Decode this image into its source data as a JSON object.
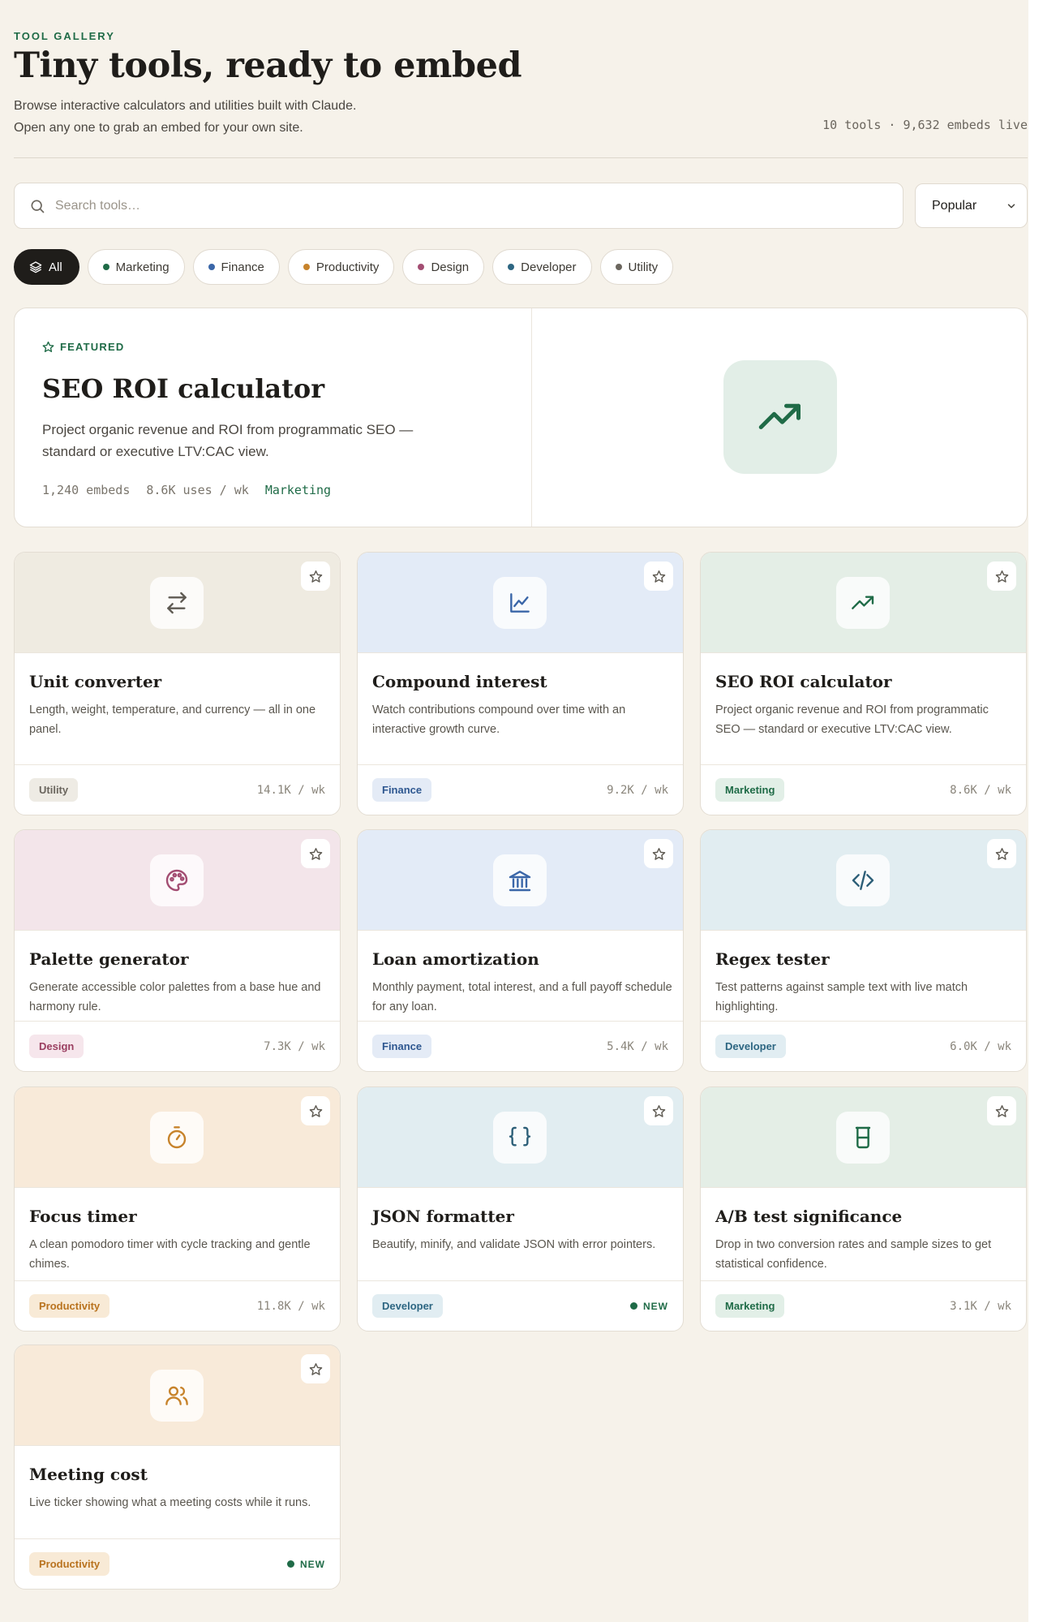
{
  "header": {
    "eyebrow": "TOOL GALLERY",
    "title": "Tiny tools, ready to embed",
    "subtitle_line1": "Browse interactive calculators and utilities built with Claude.",
    "subtitle_line2": "Open any one to grab an embed for your own site.",
    "stats": "10 tools · 9,632 embeds live"
  },
  "search": {
    "placeholder": "Search tools…"
  },
  "sort": {
    "selected": "Popular"
  },
  "filters": [
    {
      "label": "All",
      "active": true
    },
    {
      "label": "Marketing",
      "color": "#1f6b47"
    },
    {
      "label": "Finance",
      "color": "#3a66a8"
    },
    {
      "label": "Productivity",
      "color": "#c7832b"
    },
    {
      "label": "Design",
      "color": "#a34d72"
    },
    {
      "label": "Developer",
      "color": "#2d6682"
    },
    {
      "label": "Utility",
      "color": "#6b665e"
    }
  ],
  "featured": {
    "label": "FEATURED",
    "title": "SEO ROI calculator",
    "desc": "Project organic revenue and ROI from programmatic SEO — standard or executive LTV:CAC view.",
    "embeds": "1,240 embeds",
    "uses": "8.6K uses / wk",
    "category": "Marketing",
    "icon": "trending-up-icon"
  },
  "tools": [
    {
      "title": "Unit converter",
      "desc": "Length, weight, temperature, and currency — all in one panel.",
      "tag": "Utility",
      "uses": "14.1K / wk",
      "icon": "swap-arrows-icon",
      "banner": "#efebe1",
      "color": "#5e5a52"
    },
    {
      "title": "Compound interest",
      "desc": "Watch contributions compound over time with an interactive growth curve.",
      "tag": "Finance",
      "uses": "9.2K / wk",
      "icon": "line-chart-icon",
      "banner": "#e3ebf7",
      "color": "#3a66a8"
    },
    {
      "title": "SEO ROI calculator",
      "desc": "Project organic revenue and ROI from programmatic SEO — standard or executive LTV:CAC view.",
      "tag": "Marketing",
      "uses": "8.6K / wk",
      "icon": "trending-up-icon",
      "banner": "#e4eee6",
      "color": "#1f6b47"
    },
    {
      "title": "Palette generator",
      "desc": "Generate accessible color palettes from a base hue and harmony rule.",
      "tag": "Design",
      "uses": "7.3K / wk",
      "icon": "palette-icon",
      "banner": "#f3e5ea",
      "color": "#a34d72"
    },
    {
      "title": "Loan amortization",
      "desc": "Monthly payment, total interest, and a full payoff schedule for any loan.",
      "tag": "Finance",
      "uses": "5.4K / wk",
      "icon": "bank-icon",
      "banner": "#e3ebf7",
      "color": "#3a66a8"
    },
    {
      "title": "Regex tester",
      "desc": "Test patterns against sample text with live match highlighting.",
      "tag": "Developer",
      "uses": "6.0K / wk",
      "icon": "code-icon",
      "banner": "#e1edf1",
      "color": "#2d5f78"
    },
    {
      "title": "Focus timer",
      "desc": "A clean pomodoro timer with cycle tracking and gentle chimes.",
      "tag": "Productivity",
      "uses": "11.8K / wk",
      "icon": "timer-icon",
      "banner": "#f8ead9",
      "color": "#c7832b"
    },
    {
      "title": "JSON formatter",
      "desc": "Beautify, minify, and validate JSON with error pointers.",
      "tag": "Developer",
      "uses": "NEW",
      "icon": "braces-icon",
      "banner": "#e1edf1",
      "color": "#2d5f78"
    },
    {
      "title": "A/B test significance",
      "desc": "Drop in two conversion rates and sample sizes to get statistical confidence.",
      "tag": "Marketing",
      "uses": "3.1K / wk",
      "icon": "beaker-icon",
      "banner": "#e4eee6",
      "color": "#1f6b47"
    },
    {
      "title": "Meeting cost",
      "desc": "Live ticker showing what a meeting costs while it runs.",
      "tag": "Productivity",
      "uses": "NEW",
      "icon": "users-icon",
      "banner": "#f8ead9",
      "color": "#c7832b"
    }
  ]
}
